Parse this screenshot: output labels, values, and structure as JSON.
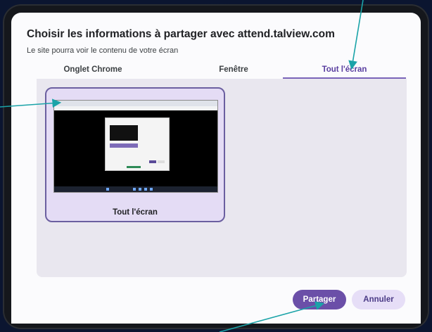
{
  "dialog": {
    "title": "Choisir les informations à partager avec attend.talview.com",
    "subtitle": "Le site pourra voir le contenu de votre écran"
  },
  "tabs": [
    {
      "label": "Onglet Chrome"
    },
    {
      "label": "Fenêtre"
    },
    {
      "label": "Tout l'écran"
    }
  ],
  "screen_tile": {
    "label": "Tout l'écran"
  },
  "buttons": {
    "share": "Partager",
    "cancel": "Annuler"
  },
  "colors": {
    "accent": "#6b4fa8",
    "annotation_arrow": "#1aa3a8"
  }
}
